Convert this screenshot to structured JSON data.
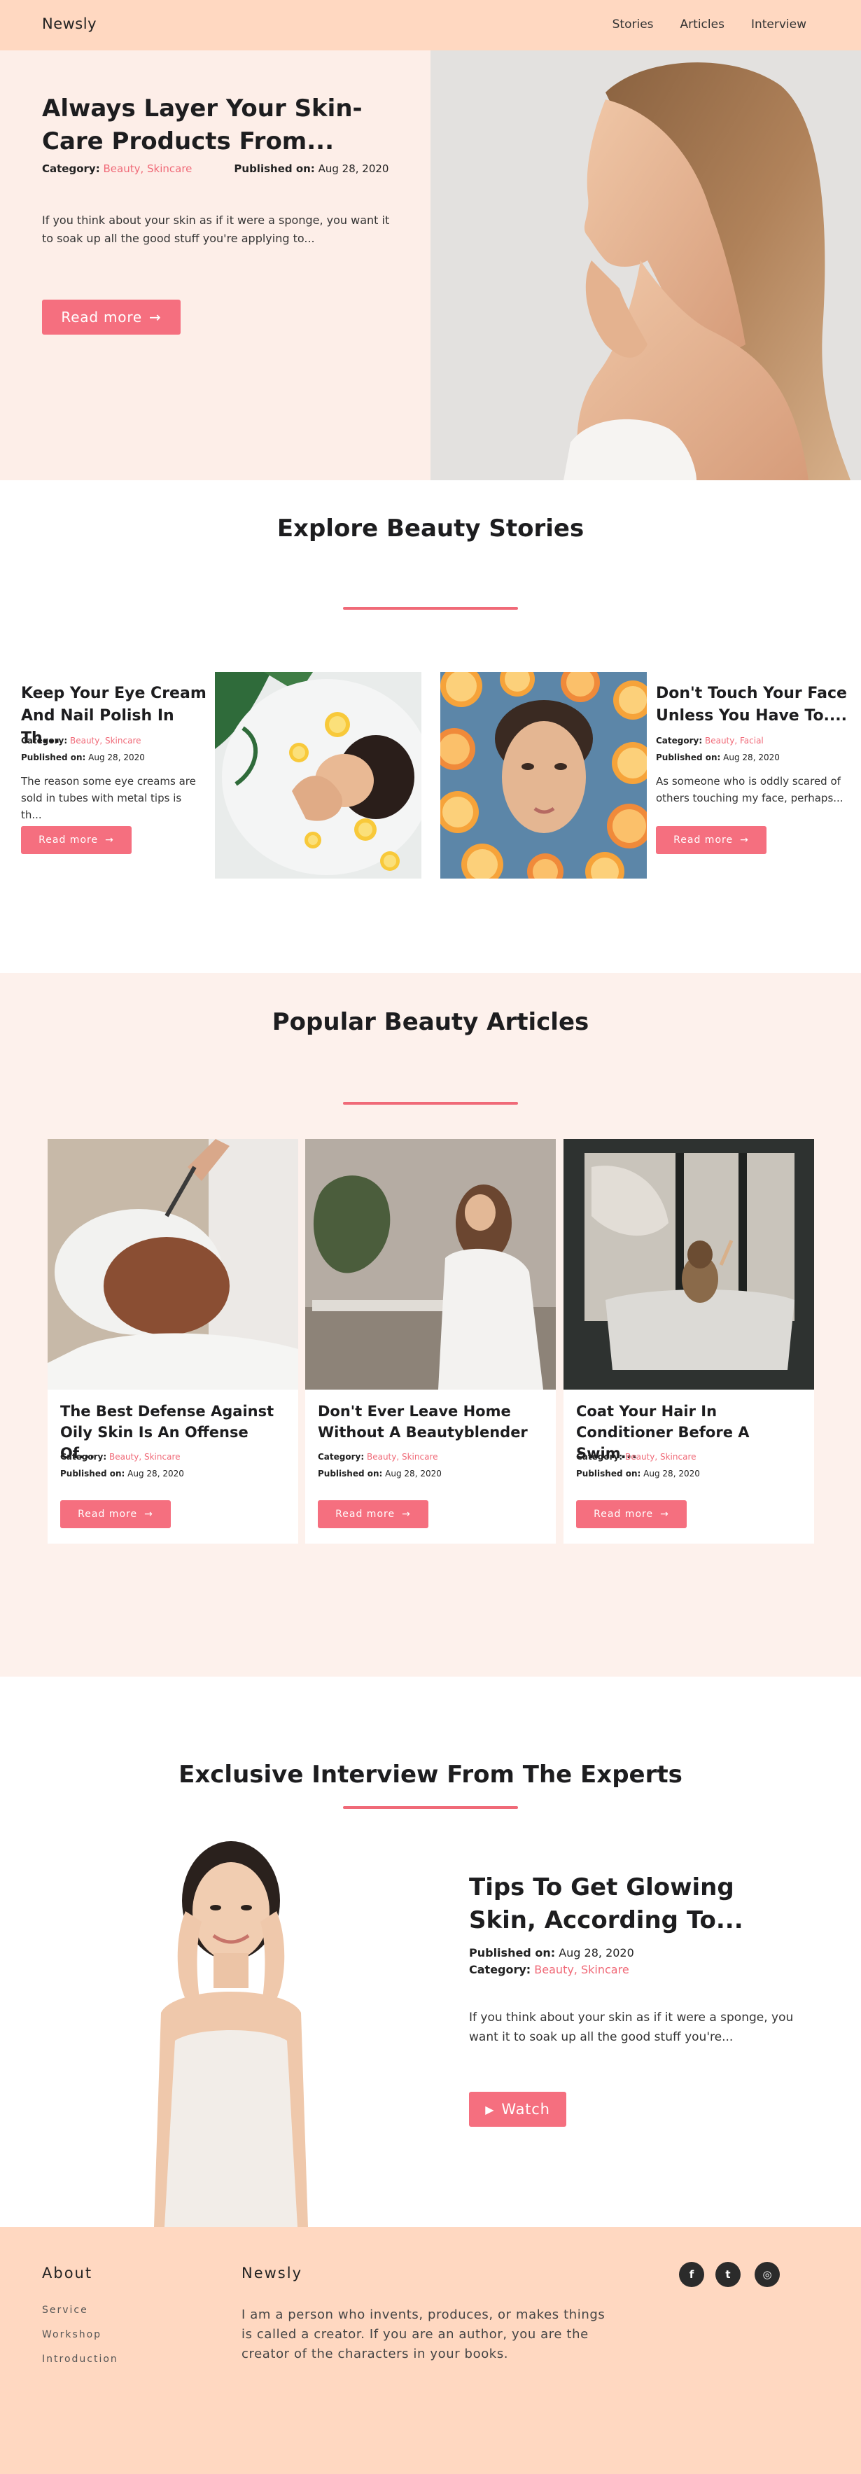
{
  "nav": {
    "brand": "Newsly",
    "links": [
      "Stories",
      "Articles",
      "Interview"
    ]
  },
  "hero": {
    "title": "Always Layer Your Skin-Care Products From...",
    "category_label": "Category:",
    "category_value": "Beauty, Skincare",
    "published_label": "Published on:",
    "published_value": "Aug 28, 2020",
    "excerpt": "If you think about your skin as if it were a sponge, you want it to soak up all the good stuff you're applying to...",
    "button": "Read more",
    "button_arrow": "→"
  },
  "stories": {
    "title": "Explore Beauty Stories",
    "items": [
      {
        "title": "Keep Your Eye Cream And Nail Polish In Th...",
        "category_label": "Category:",
        "category_value": "Beauty, Skincare",
        "published_label": "Published on:",
        "published_value": "Aug 28, 2020",
        "excerpt": "The reason some eye creams are sold in tubes with metal tips is th...",
        "button": "Read more",
        "button_arrow": "→"
      },
      {
        "title": "Don't Touch Your Face Unless You Have To....",
        "category_label": "Category:",
        "category_value": "Beauty, Facial",
        "published_label": "Published on:",
        "published_value": "Aug 28, 2020",
        "excerpt": "As someone who is oddly scared of others touching my face, perhaps...",
        "button": "Read more",
        "button_arrow": "→"
      }
    ]
  },
  "articles": {
    "title": "Popular Beauty Articles",
    "items": [
      {
        "title": "The Best Defense Against Oily Skin Is An Offense Of...",
        "category_label": "Category:",
        "category_value": "Beauty, Skincare",
        "published_label": "Published on:",
        "published_value": "Aug 28, 2020",
        "button": "Read more",
        "button_arrow": "→"
      },
      {
        "title": "Don't Ever Leave Home Without A Beautyblender",
        "category_label": "Category:",
        "category_value": "Beauty, Skincare",
        "published_label": "Published on:",
        "published_value": "Aug 28, 2020",
        "button": "Read more",
        "button_arrow": "→"
      },
      {
        "title": "Coat Your Hair In Conditioner Before A Swim...",
        "category_label": "Category:",
        "category_value": "Beauty, Skincare",
        "published_label": "Published on:",
        "published_value": "Aug 28, 2020",
        "button": "Read more",
        "button_arrow": "→"
      }
    ]
  },
  "interview": {
    "section_title": "Exclusive Interview From The Experts",
    "title": "Tips To Get Glowing Skin, According To...",
    "published_label": "Published on:",
    "published_value": "Aug 28, 2020",
    "category_label": "Category:",
    "category_value": "Beauty, Skincare",
    "excerpt": "If you think about your skin as if it were a sponge, you want it to soak up all the good stuff you're...",
    "button": "Watch",
    "button_icon": "▶"
  },
  "footer": {
    "about_title": "About",
    "links": [
      "Service",
      "Workshop",
      "Introduction"
    ],
    "brand_title": "Newsly",
    "text": "I am a person who invents, produces, or makes things is called a creator. If you are an author, you are the creator of the characters in your books.",
    "social": [
      {
        "icon": "facebook-icon",
        "glyph": "f"
      },
      {
        "icon": "twitter-icon",
        "glyph": "t"
      },
      {
        "icon": "instagram-icon",
        "glyph": "◎"
      }
    ]
  },
  "colors": {
    "accent": "#f56f7f",
    "nav_bg": "#ffd8c1",
    "hero_bg": "#fdeee8",
    "articles_bg": "#fdf1ec"
  }
}
